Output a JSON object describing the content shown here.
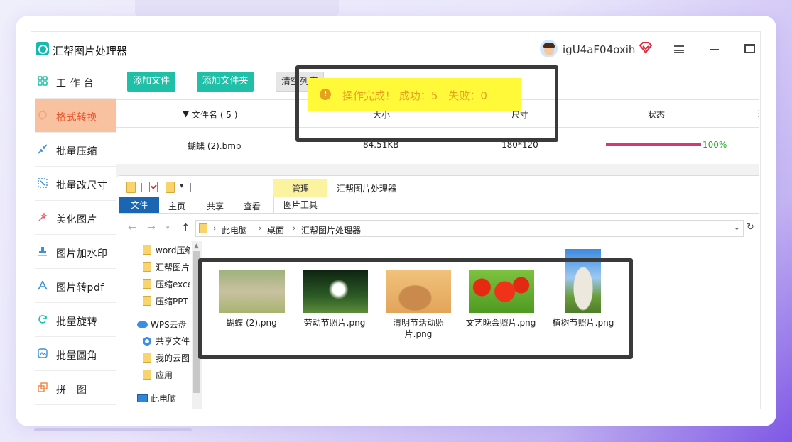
{
  "app": {
    "title": "汇帮图片处理器",
    "username": "igU4aF04oxih",
    "accent_color": "#1fbfa8",
    "active_color": "#f8c2a1"
  },
  "sidebar": {
    "items": [
      {
        "label": "工 作 台",
        "icon": "grid-icon"
      },
      {
        "label": "格式转换",
        "icon": "convert-icon",
        "active": true
      },
      {
        "label": "批量压缩",
        "icon": "compress-icon"
      },
      {
        "label": "批量改尺寸",
        "icon": "resize-icon"
      },
      {
        "label": "美化图片",
        "icon": "beautify-icon"
      },
      {
        "label": "图片加水印",
        "icon": "watermark-icon"
      },
      {
        "label": "图片转pdf",
        "icon": "pdf-icon"
      },
      {
        "label": "批量旋转",
        "icon": "rotate-icon"
      },
      {
        "label": "批量圆角",
        "icon": "round-corner-icon"
      },
      {
        "label": "拼　图",
        "icon": "collage-icon"
      }
    ]
  },
  "toolbar": {
    "add_file": "添加文件",
    "add_folder": "添加文件夹",
    "clear_list": "清空列表"
  },
  "table": {
    "columns": {
      "name": "文件名 ( 5 )",
      "size": "大小",
      "dimensions": "尺寸",
      "status": "状态"
    },
    "rows": [
      {
        "name": "蝴蝶 (2).bmp",
        "size": "84.51KB",
        "dimensions": "180*120",
        "progress": 1.0,
        "progress_label": "100%"
      }
    ]
  },
  "toast": {
    "text": "操作完成！ 成功：5　失败：0"
  },
  "explorer": {
    "manage_tab": "管理",
    "title": "汇帮图片处理器",
    "ribbon_tabs": {
      "file": "文件",
      "home": "主页",
      "share": "共享",
      "view": "查看",
      "picture_tools": "图片工具"
    },
    "breadcrumb": [
      "此电脑",
      "桌面",
      "汇帮图片处理器"
    ],
    "nav": {
      "folders": [
        "word压缩",
        "汇帮图片",
        "压缩excel",
        "压缩PPT"
      ],
      "cloud_root": "WPS云盘",
      "cloud_items": [
        "共享文件",
        "我的云图",
        "应用"
      ],
      "pc": "此电脑"
    },
    "files": [
      {
        "label": "蝴蝶 (2).png"
      },
      {
        "label": "劳动节照片.png"
      },
      {
        "label": "清明节活动照片.png"
      },
      {
        "label": "文艺晚会照片.png"
      },
      {
        "label": "植树节照片.png"
      }
    ]
  }
}
